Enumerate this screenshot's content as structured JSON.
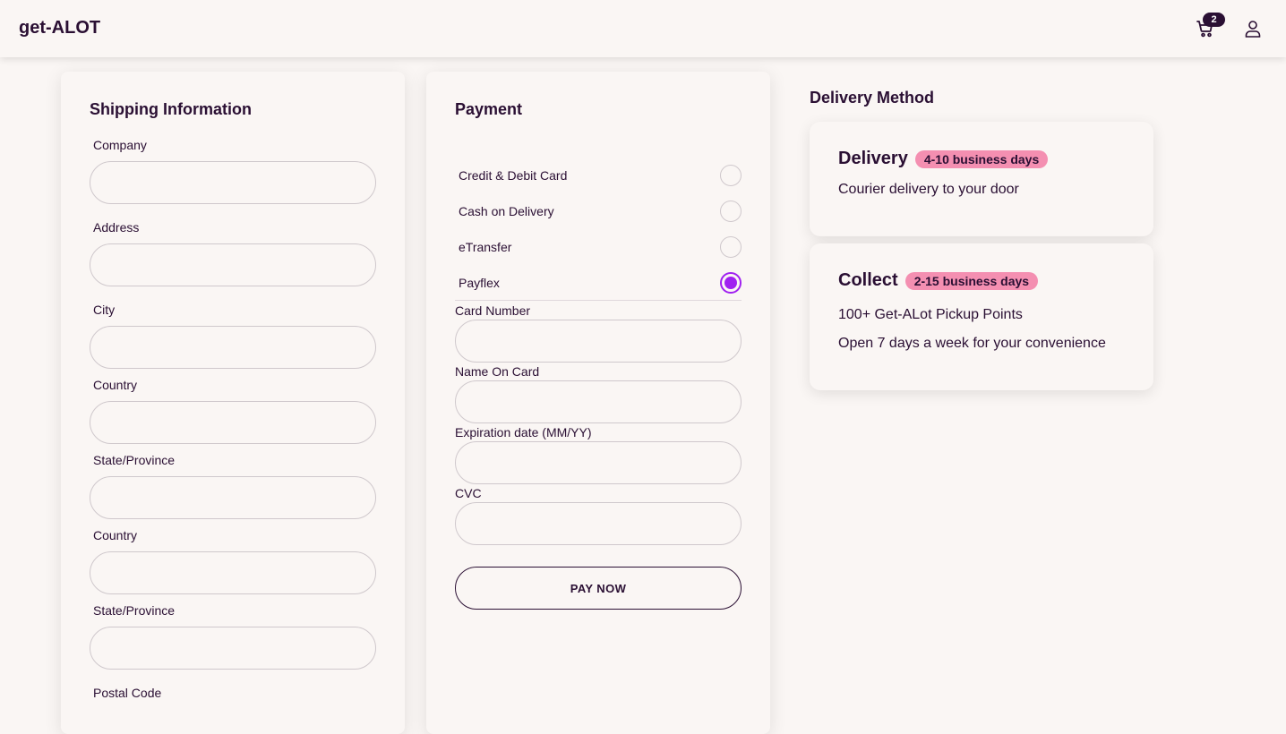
{
  "header": {
    "brand": "get-ALOT",
    "cart_count": "2",
    "cart_icon": "cart-icon",
    "user_icon": "user-icon"
  },
  "shipping": {
    "title": "Shipping Information",
    "fields": [
      {
        "label": "Company",
        "value": ""
      },
      {
        "label": "Address",
        "value": ""
      },
      {
        "label": "City",
        "value": ""
      },
      {
        "label": "Country",
        "value": ""
      },
      {
        "label": "State/Province",
        "value": ""
      },
      {
        "label": "Country",
        "value": ""
      },
      {
        "label": "State/Province",
        "value": ""
      },
      {
        "label": "Postal Code",
        "value": ""
      }
    ]
  },
  "payment": {
    "title": "Payment",
    "methods": [
      {
        "label": "Credit & Debit Card",
        "selected": false
      },
      {
        "label": "Cash on Delivery",
        "selected": false
      },
      {
        "label": "eTransfer",
        "selected": false
      },
      {
        "label": "Payflex",
        "selected": true
      }
    ],
    "fields": [
      {
        "label": "Card Number",
        "value": ""
      },
      {
        "label": "Name On Card",
        "value": ""
      },
      {
        "label": "Expiration date (MM/YY)",
        "value": ""
      },
      {
        "label": "CVC",
        "value": ""
      }
    ],
    "submit_label": "PAY NOW"
  },
  "delivery": {
    "title": "Delivery Method",
    "options": [
      {
        "name": "Delivery",
        "badge": "4-10 business days",
        "lines": [
          "Courier delivery to your door"
        ]
      },
      {
        "name": "Collect",
        "badge": "2-15 business days",
        "lines": [
          "100+ Get-ALot Pickup Points",
          "Open 7 days a week for your convenience"
        ]
      }
    ]
  },
  "colors": {
    "background": "#faf6f4",
    "text": "#2a0f33",
    "accent": "#a020f0",
    "badge": "#f48fb1"
  }
}
